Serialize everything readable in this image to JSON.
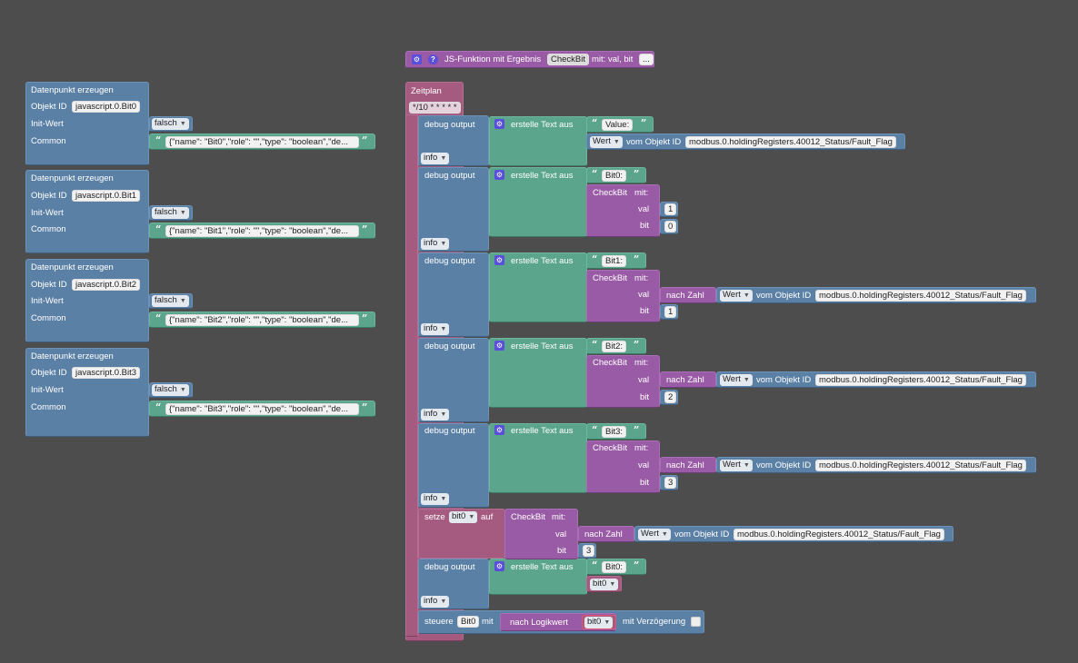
{
  "function_block": {
    "label": "JS-Funktion mit Ergebnis",
    "name": "CheckBit",
    "params": "mit: val, bit",
    "more": "..."
  },
  "datapoints": [
    {
      "title": "Datenpunkt erzeugen",
      "obj_label": "Objekt ID",
      "obj_id": "javascript.0.Bit0",
      "init_label": "Init-Wert",
      "init_value": "falsch",
      "common_label": "Common",
      "common_value": "{\"name\": \"Bit0\",\"role\": \"\",\"type\": \"boolean\",\"de..."
    },
    {
      "title": "Datenpunkt erzeugen",
      "obj_label": "Objekt ID",
      "obj_id": "javascript.0.Bit1",
      "init_label": "Init-Wert",
      "init_value": "falsch",
      "common_label": "Common",
      "common_value": "{\"name\": \"Bit1\",\"role\": \"\",\"type\": \"boolean\",\"de..."
    },
    {
      "title": "Datenpunkt erzeugen",
      "obj_label": "Objekt ID",
      "obj_id": "javascript.0.Bit2",
      "init_label": "Init-Wert",
      "init_value": "falsch",
      "common_label": "Common",
      "common_value": "{\"name\": \"Bit2\",\"role\": \"\",\"type\": \"boolean\",\"de..."
    },
    {
      "title": "Datenpunkt erzeugen",
      "obj_label": "Objekt ID",
      "obj_id": "javascript.0.Bit3",
      "init_label": "Init-Wert",
      "init_value": "falsch",
      "common_label": "Common",
      "common_value": "{\"name\": \"Bit3\",\"role\": \"\",\"type\": \"boolean\",\"de..."
    }
  ],
  "schedule": {
    "label": "Zeitplan",
    "cron": "*/10 * * * * *"
  },
  "debug": {
    "label": "debug output",
    "level": "info",
    "text_label": "erstelle Text aus",
    "value_text": "Value:",
    "wert": "Wert",
    "vom_objekt": "vom Objekt ID",
    "object_id": "modbus.0.holdingRegisters.40012_Status/Fault_Flag",
    "bit_texts": [
      "Bit0:",
      "Bit1:",
      "Bit2:",
      "Bit3:"
    ],
    "checkbit": "CheckBit",
    "mit": "mit:",
    "val": "val",
    "bit": "bit",
    "nach_zahl": "nach Zahl",
    "bit_values": [
      "0",
      "1",
      "2",
      "3"
    ],
    "val_first": "1"
  },
  "setze": {
    "label": "setze",
    "var": "bit0",
    "auf": "auf",
    "bit_value": "3"
  },
  "last_debug": {
    "text": "Bit0:",
    "var": "bit0"
  },
  "steuere": {
    "label": "steuere",
    "target": "Bit0",
    "mit": "mit",
    "nach_logik": "nach Logikwert",
    "var": "bit0",
    "delay": "mit Verzögerung"
  },
  "colors": {
    "logic": "#5b80a5",
    "schedule": "#a55b80",
    "text": "#5ba58c",
    "function": "#995ba5",
    "gear": "#5a4fd8"
  }
}
